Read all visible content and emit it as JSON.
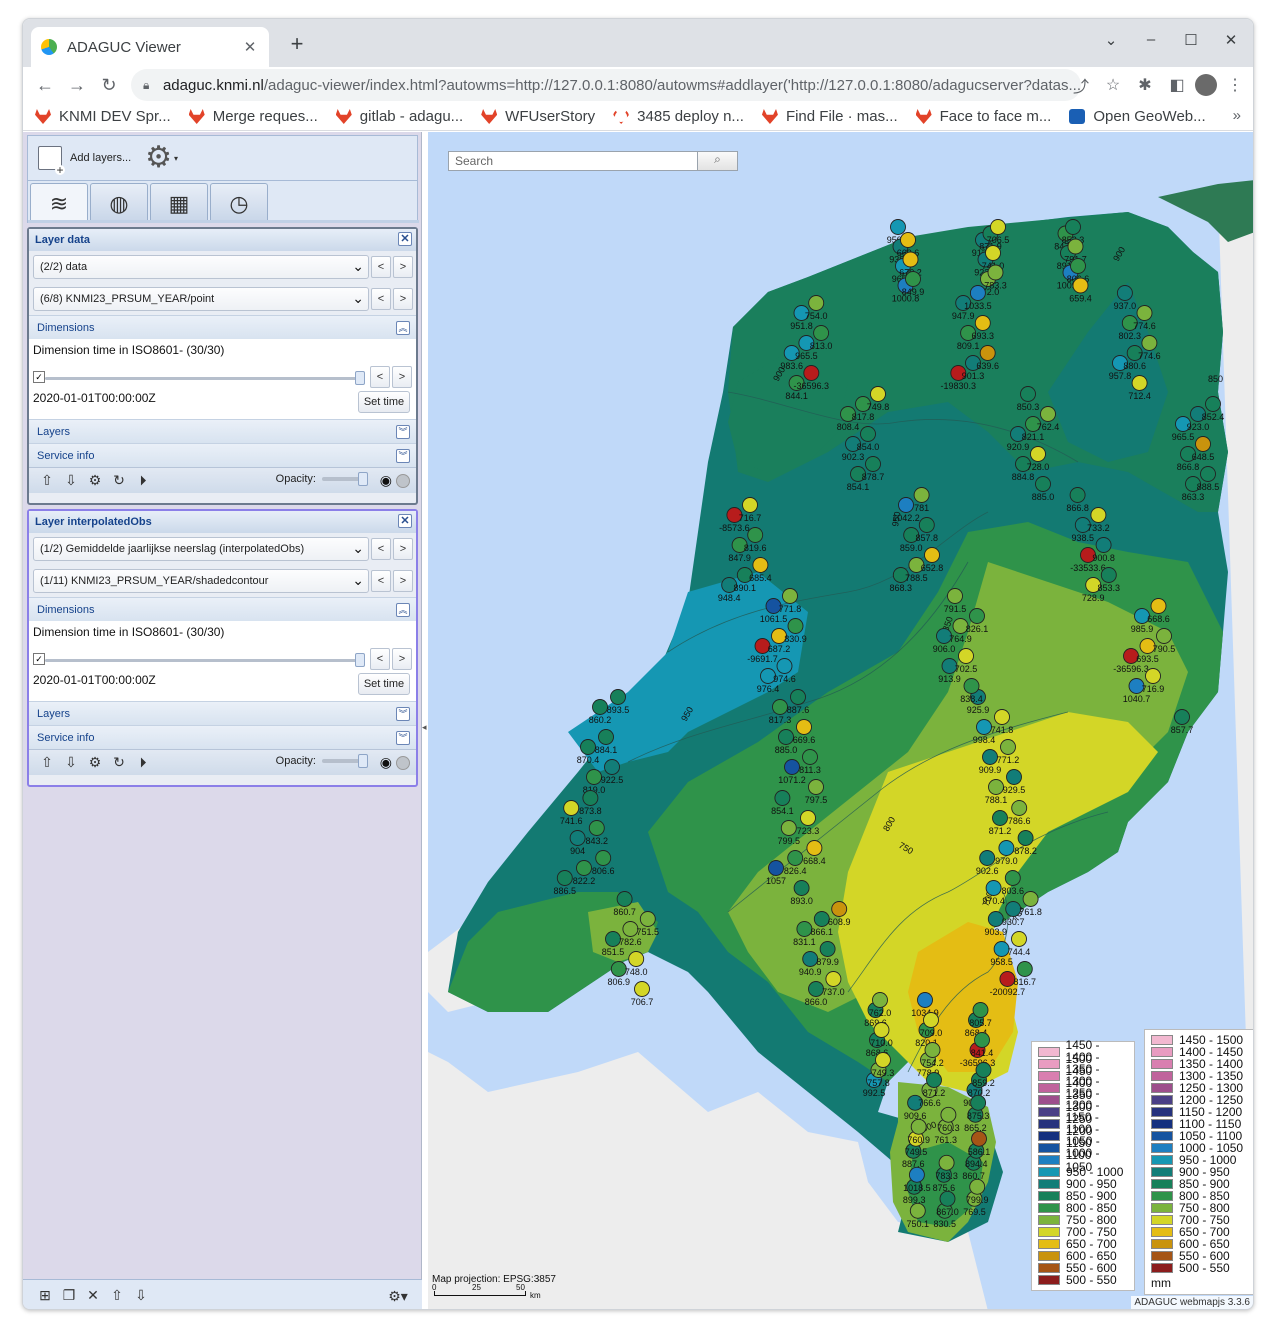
{
  "browser": {
    "tab_title": "ADAGUC Viewer",
    "tab_close": "✕",
    "new_tab": "+",
    "url_host": "adaguc.knmi.nl",
    "url_path": "/adaguc-viewer/index.html?autowms=http://127.0.0.1:8080/autowms#addlayer('http://127.0.0.1:8080/adagucserver?datas...",
    "bookmarks": [
      "KNMI DEV Spr...",
      "Merge reques...",
      "gitlab - adagu...",
      "WFUserStory",
      "3485 deploy n...",
      "Find File · mas...",
      "Face to face m...",
      "Open GeoWeb..."
    ],
    "bookmarks_more": "»"
  },
  "sidebar": {
    "add_layers_label": "Add layers...",
    "layers": [
      {
        "title": "Layer data",
        "service_select": "(2/2) data",
        "layer_select": "(6/8) KNMI23_PRSUM_YEAR/point",
        "dimensions_label": "Dimensions",
        "dimension_title": "Dimension time in ISO8601- (30/30)",
        "dimension_value": "2020-01-01T00:00:00Z",
        "set_time_label": "Set time",
        "layers_label": "Layers",
        "service_info_label": "Service info",
        "opacity_label": "Opacity:"
      },
      {
        "title": "Layer interpolatedObs",
        "service_select": "(1/2) Gemiddelde jaarlijkse neerslag (interpolatedObs)",
        "layer_select": "(1/11) KNMI23_PRSUM_YEAR/shadedcontour",
        "dimensions_label": "Dimensions",
        "dimension_title": "Dimension time in ISO8601- (30/30)",
        "dimension_value": "2020-01-01T00:00:00Z",
        "set_time_label": "Set time",
        "layers_label": "Layers",
        "service_info_label": "Service info",
        "opacity_label": "Opacity:"
      }
    ]
  },
  "map": {
    "search_placeholder": "Search",
    "projection_label": "Map projection: EPSG:3857",
    "scale_labels": [
      "0",
      "25",
      "50",
      "km"
    ],
    "credit": "ADAGUC webmapjs 3.3.6",
    "legend_unit": "mm",
    "legend_classes": [
      {
        "label": "1450 - 1500",
        "color": "#f2b8d0"
      },
      {
        "label": "1400 - 1450",
        "color": "#e99cc1"
      },
      {
        "label": "1350 - 1400",
        "color": "#d97fb0"
      },
      {
        "label": "1300 - 1350",
        "color": "#c0639c"
      },
      {
        "label": "1250 - 1300",
        "color": "#9d4f8c"
      },
      {
        "label": "1200 - 1250",
        "color": "#4a3f86"
      },
      {
        "label": "1150 - 1200",
        "color": "#26327d"
      },
      {
        "label": "1100 - 1150",
        "color": "#14307f"
      },
      {
        "label": "1050 - 1100",
        "color": "#1553a0"
      },
      {
        "label": "1000 - 1050",
        "color": "#1d7fc1"
      },
      {
        "label": "950 - 1000",
        "color": "#1597b3"
      },
      {
        "label": "900 - 950",
        "color": "#127d78"
      },
      {
        "label": "850 - 900",
        "color": "#17805a"
      },
      {
        "label": "800 - 850",
        "color": "#2f934a"
      },
      {
        "label": "750 - 800",
        "color": "#7bb33d"
      },
      {
        "label": "700 - 750",
        "color": "#d3d627"
      },
      {
        "label": "650 - 700",
        "color": "#e4bd14"
      },
      {
        "label": "600 - 650",
        "color": "#c9930d"
      },
      {
        "label": "550 - 600",
        "color": "#a55516"
      },
      {
        "label": "500 - 550",
        "color": "#8c1d1d"
      }
    ],
    "station_labels": [
      {
        "t": "950.7"
      },
      {
        "t": "983.6"
      },
      {
        "t": "808.4"
      },
      {
        "t": "868.3"
      },
      {
        "t": "906.0"
      },
      {
        "t": "925.9"
      },
      {
        "t": "902.6"
      },
      {
        "t": "903.9"
      },
      {
        "t": "992.5"
      },
      {
        "t": "887.6"
      },
      {
        "t": "847.2"
      },
      {
        "t": "957.8"
      },
      {
        "t": "965.5"
      },
      {
        "t": "948.4"
      },
      {
        "t": "-9691.7"
      },
      {
        "t": "817.3"
      },
      {
        "t": "1057"
      },
      {
        "t": "831.1"
      },
      {
        "t": "906.2"
      },
      {
        "t": "860.7"
      },
      {
        "t": "913.7"
      },
      {
        "t": "-19830.3"
      },
      {
        "t": "920.9"
      },
      {
        "t": "866.8"
      },
      {
        "t": "-36596.3"
      },
      {
        "t": "857.7"
      },
      {
        "t": "886.5"
      },
      {
        "t": "851.5"
      },
      {
        "t": "1034.9"
      },
      {
        "t": "875.6"
      },
      {
        "t": "938.2"
      },
      {
        "t": "844.1"
      },
      {
        "t": "902.3"
      },
      {
        "t": "1042.2"
      },
      {
        "t": "913.9"
      },
      {
        "t": "998.4"
      },
      {
        "t": "970.4"
      },
      {
        "t": "958.5"
      },
      {
        "t": "869.6"
      },
      {
        "t": "899.3"
      },
      {
        "t": "891.9"
      },
      {
        "t": "937.0"
      },
      {
        "t": "866.8"
      },
      {
        "t": "-8573.6"
      },
      {
        "t": "976.4"
      },
      {
        "t": "885.0"
      },
      {
        "t": "854.1"
      },
      {
        "t": "940.9"
      },
      {
        "t": "868.4"
      },
      {
        "t": "769.5"
      },
      {
        "t": "922.8"
      },
      {
        "t": "947.9"
      },
      {
        "t": "884.8"
      },
      {
        "t": "938.5"
      },
      {
        "t": "1040.7"
      },
      {
        "t": "870.4"
      },
      {
        "t": "741.6"
      },
      {
        "t": "806.9"
      },
      {
        "t": "820.1"
      },
      {
        "t": "830.5"
      },
      {
        "t": "965.8"
      },
      {
        "t": "951.8"
      },
      {
        "t": "854.1"
      },
      {
        "t": "859.0"
      },
      {
        "t": "791.5"
      },
      {
        "t": "909.9"
      },
      {
        "t": "871.2"
      },
      {
        "t": "-20092.7"
      },
      {
        "t": "868.6"
      },
      {
        "t": "909.6"
      },
      {
        "t": "1009.6"
      },
      {
        "t": "802.3"
      },
      {
        "t": "863.3"
      },
      {
        "t": "847.9"
      },
      {
        "t": "1061.5"
      },
      {
        "t": "1071.2"
      },
      {
        "t": "799.5"
      },
      {
        "t": "866.0"
      },
      {
        "t": "-36596.3"
      },
      {
        "t": "865.2"
      },
      {
        "t": "772.0"
      },
      {
        "t": "809.1"
      },
      {
        "t": "850.3"
      },
      {
        "t": "-33533.6"
      },
      {
        "t": "985.9"
      },
      {
        "t": "819.0"
      },
      {
        "t": "904"
      },
      {
        "t": "860.7"
      },
      {
        "t": "778.9"
      },
      {
        "t": "761.3"
      },
      {
        "t": "1000.8"
      },
      {
        "t": "965.5"
      },
      {
        "t": "817.8"
      },
      {
        "t": "788.5"
      },
      {
        "t": "764.9"
      },
      {
        "t": "788.1"
      },
      {
        "t": "979.0"
      },
      {
        "t": "930.7"
      },
      {
        "t": "757.8"
      },
      {
        "t": "749.5"
      },
      {
        "t": "852.3"
      },
      {
        "t": "880.6"
      },
      {
        "t": "923.0"
      },
      {
        "t": "890.1"
      },
      {
        "t": "687.2"
      },
      {
        "t": "887.6"
      },
      {
        "t": "826.4"
      },
      {
        "t": "866.1"
      },
      {
        "t": "870.2"
      },
      {
        "t": "894.4"
      },
      {
        "t": "871.9"
      },
      {
        "t": "901.3"
      },
      {
        "t": "821.1"
      },
      {
        "t": "728.9"
      },
      {
        "t": "693.5"
      },
      {
        "t": "860.2"
      },
      {
        "t": "822.2"
      },
      {
        "t": "782.6"
      },
      {
        "t": "766.6"
      },
      {
        "t": "783.3"
      },
      {
        "t": "669.6"
      },
      {
        "t": "-36596.3"
      },
      {
        "t": "854.0"
      },
      {
        "t": "781"
      },
      {
        "t": "702.5"
      },
      {
        "t": "741.8"
      },
      {
        "t": "803.6"
      },
      {
        "t": "744.4"
      },
      {
        "t": "762.0"
      },
      {
        "t": "1018.5"
      },
      {
        "t": "791.7"
      },
      {
        "t": "712.4"
      },
      {
        "t": "648.5"
      },
      {
        "t": "716.7"
      },
      {
        "t": "974.6"
      },
      {
        "t": "669.6"
      },
      {
        "t": "893.0"
      },
      {
        "t": "879.9"
      },
      {
        "t": "805.7"
      },
      {
        "t": "799.9"
      },
      {
        "t": "741.0"
      },
      {
        "t": "1033.5"
      },
      {
        "t": "728.0"
      },
      {
        "t": "733.2"
      },
      {
        "t": "716.9"
      },
      {
        "t": "884.1"
      },
      {
        "t": "873.8"
      },
      {
        "t": "748.0"
      },
      {
        "t": "709.0"
      },
      {
        "t": "867.0"
      },
      {
        "t": "670.2"
      },
      {
        "t": "754.0"
      },
      {
        "t": "878.7"
      },
      {
        "t": "857.8"
      },
      {
        "t": "838.4"
      },
      {
        "t": "771.2"
      },
      {
        "t": "786.6"
      },
      {
        "t": "816.7"
      },
      {
        "t": "710.0"
      },
      {
        "t": "750.1"
      },
      {
        "t": "806.6"
      },
      {
        "t": "774.6"
      },
      {
        "t": "888.5"
      },
      {
        "t": "819.6"
      },
      {
        "t": "771.8"
      },
      {
        "t": "811.3"
      },
      {
        "t": "723.3"
      },
      {
        "t": "737.0"
      },
      {
        "t": "841.4"
      },
      {
        "t": "875.3"
      },
      {
        "t": "783.3"
      },
      {
        "t": "693.3"
      },
      {
        "t": "885.0"
      },
      {
        "t": "900.8"
      },
      {
        "t": "668.6"
      },
      {
        "t": "922.5"
      },
      {
        "t": "843.2"
      },
      {
        "t": "706.7"
      },
      {
        "t": "754.2"
      },
      {
        "t": "760.3"
      },
      {
        "t": "849.9"
      },
      {
        "t": "813.0"
      },
      {
        "t": "749.8"
      },
      {
        "t": "652.8"
      },
      {
        "t": "826.1"
      },
      {
        "t": "929.5"
      },
      {
        "t": "878.2"
      },
      {
        "t": "761.8"
      },
      {
        "t": "749.3"
      },
      {
        "t": "760.9"
      },
      {
        "t": "659.4"
      },
      {
        "t": "774.6"
      },
      {
        "t": "852.4"
      },
      {
        "t": "685.4"
      },
      {
        "t": "830.9"
      },
      {
        "t": "797.5"
      },
      {
        "t": "668.4"
      },
      {
        "t": "608.9"
      },
      {
        "t": "859.2"
      },
      {
        "t": "586.1"
      },
      {
        "t": "706.5"
      },
      {
        "t": "639.6"
      },
      {
        "t": "762.4"
      },
      {
        "t": "853.3"
      },
      {
        "t": "790.5"
      },
      {
        "t": "893.5"
      },
      {
        "t": "806.6"
      },
      {
        "t": "751.5"
      },
      {
        "t": "871.2"
      }
    ],
    "contour_labels": [
      "900",
      "850",
      "900",
      "950",
      "950",
      "850",
      "800",
      "750",
      "700",
      "900",
      "800",
      "750",
      "700",
      "700",
      "800"
    ]
  }
}
